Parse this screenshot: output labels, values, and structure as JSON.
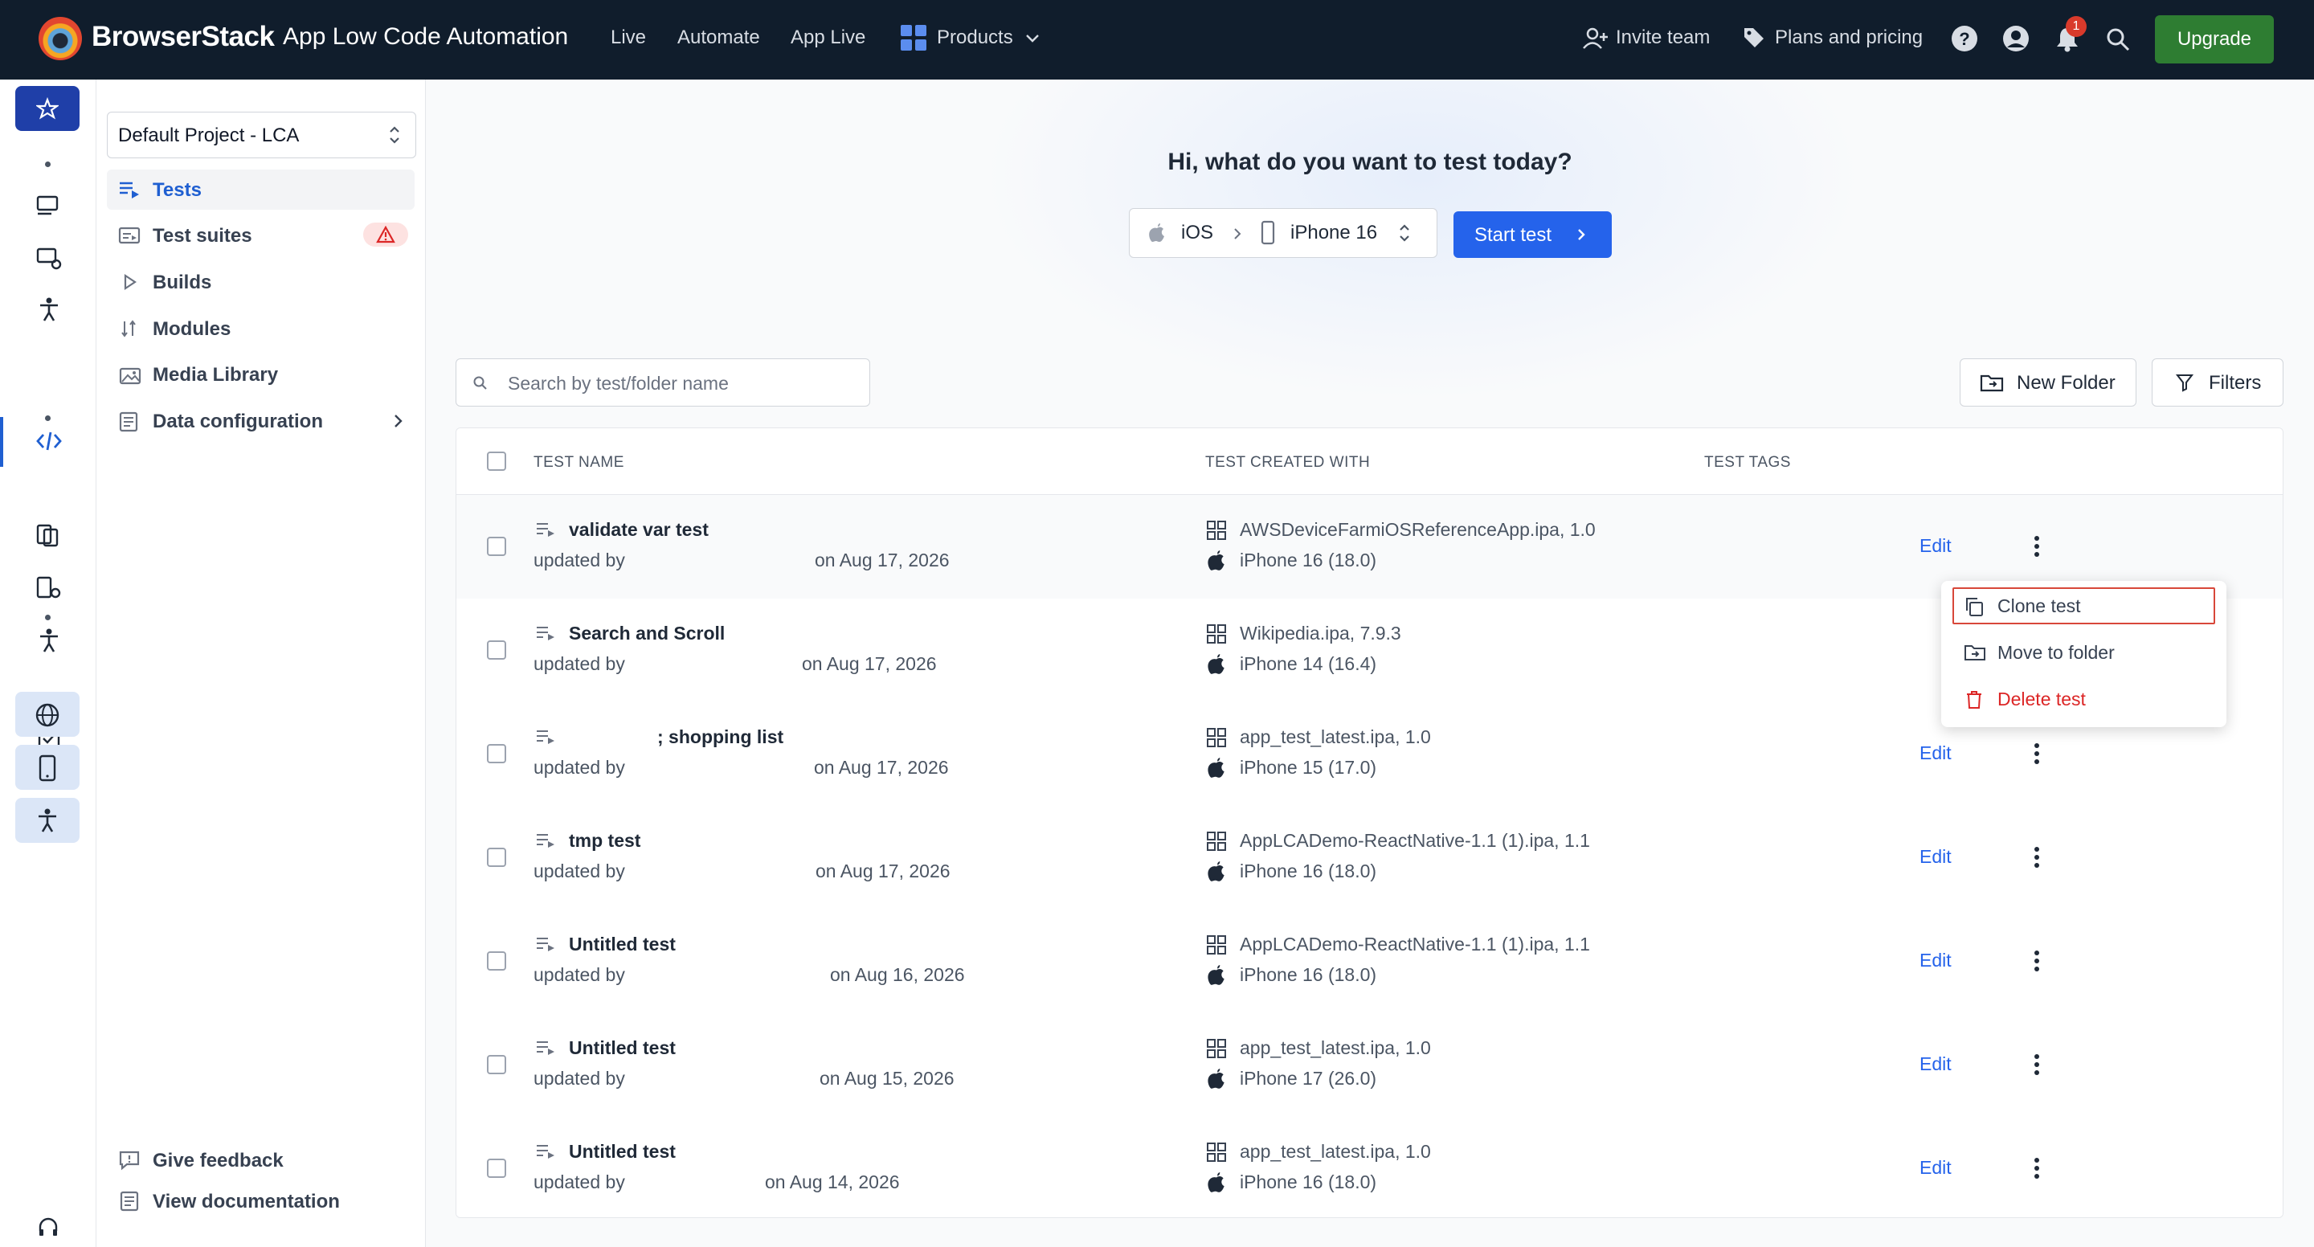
{
  "header": {
    "brand": "BrowserStack",
    "product": "App Low Code Automation",
    "nav": [
      "Live",
      "Automate",
      "App Live",
      "Products"
    ],
    "invite": "Invite team",
    "plans": "Plans and pricing",
    "notifications_count": "1",
    "upgrade": "Upgrade"
  },
  "sidebar": {
    "project": "Default Project - LCA",
    "items": [
      {
        "label": "Tests",
        "icon": "tests-icon",
        "active": true
      },
      {
        "label": "Test suites",
        "icon": "test-suites-icon",
        "warning": true
      },
      {
        "label": "Builds",
        "icon": "play-icon"
      },
      {
        "label": "Modules",
        "icon": "modules-icon"
      },
      {
        "label": "Media Library",
        "icon": "media-icon"
      },
      {
        "label": "Data configuration",
        "icon": "data-config-icon",
        "has_chevron": true
      }
    ],
    "footer": [
      {
        "label": "Give feedback",
        "icon": "feedback-icon"
      },
      {
        "label": "View documentation",
        "icon": "documentation-icon"
      }
    ]
  },
  "hero": {
    "title": "Hi, what do you want to test today?",
    "os": "iOS",
    "device": "iPhone 16",
    "start": "Start test"
  },
  "toolbar": {
    "search_placeholder": "Search by test/folder name",
    "new_folder": "New Folder",
    "filters": "Filters"
  },
  "table": {
    "columns": [
      "TEST NAME",
      "TEST CREATED WITH",
      "TEST TAGS"
    ],
    "edit_label": "Edit",
    "updated_by_label": "updated by",
    "rows": [
      {
        "name": "validate var test",
        "date": "on Aug 17, 2026",
        "app": "AWSDeviceFarmiOSReferenceApp.ipa, 1.0",
        "device": "iPhone 16 (18.0)"
      },
      {
        "name": "Search and Scroll",
        "date": "on Aug 17, 2026",
        "app": "Wikipedia.ipa, 7.9.3",
        "device": "iPhone 14 (16.4)"
      },
      {
        "name": "; shopping list",
        "date": "on Aug 17, 2026",
        "app": "app_test_latest.ipa, 1.0",
        "device": "iPhone 15 (17.0)"
      },
      {
        "name": "tmp test",
        "date": "on Aug 17, 2026",
        "app": "AppLCADemo-ReactNative-1.1 (1).ipa, 1.1",
        "device": "iPhone 16 (18.0)"
      },
      {
        "name": "Untitled test",
        "date": "on Aug 16, 2026",
        "app": "AppLCADemo-ReactNative-1.1 (1).ipa, 1.1",
        "device": "iPhone 16 (18.0)"
      },
      {
        "name": "Untitled test",
        "date": "on Aug 15, 2026",
        "app": "app_test_latest.ipa, 1.0",
        "device": "iPhone 17 (26.0)"
      },
      {
        "name": "Untitled test",
        "date": "on Aug 14, 2026",
        "app": "app_test_latest.ipa, 1.0",
        "device": "iPhone 16 (18.0)"
      }
    ]
  },
  "row_menu": {
    "items": [
      "Clone test",
      "Move to folder",
      "Delete test"
    ],
    "selected": "Clone test"
  },
  "colors": {
    "topbar": "#101d2c",
    "accent": "#2563eb",
    "upgrade": "#2e7d32",
    "danger": "#dc2626"
  }
}
